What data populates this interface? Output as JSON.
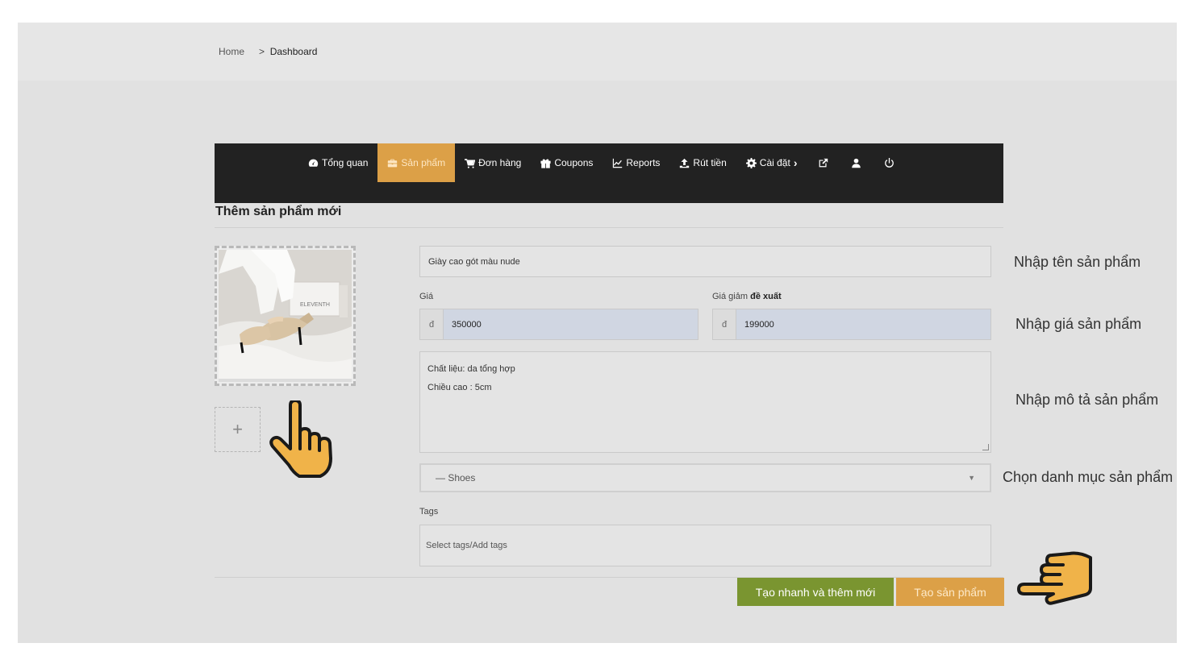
{
  "breadcrumb": {
    "home": "Home",
    "separator": ">",
    "current": "Dashboard"
  },
  "nav": {
    "items": [
      {
        "label": "Tổng quan",
        "icon": "dashboard-icon",
        "active": false
      },
      {
        "label": "Sản phẩm",
        "icon": "briefcase-icon",
        "active": true
      },
      {
        "label": "Đơn hàng",
        "icon": "cart-icon",
        "active": false
      },
      {
        "label": "Coupons",
        "icon": "gift-icon",
        "active": false
      },
      {
        "label": "Reports",
        "icon": "chart-icon",
        "active": false
      },
      {
        "label": "Rút tiền",
        "icon": "upload-icon",
        "active": false
      },
      {
        "label": "Cài đặt",
        "icon": "gear-icon",
        "active": false
      }
    ],
    "settings_chevron": "›"
  },
  "page": {
    "title": "Thêm sản phẩm mới"
  },
  "form": {
    "product_name": "Giày cao gót màu nude",
    "price_label": "Giá",
    "sale_price_label": "Giá giảm",
    "sale_price_label_bold": "đề xuất",
    "currency_symbol": "đ",
    "price": "350000",
    "sale_price": "199000",
    "description_lines": [
      "Chất liệu: da tổng hợp",
      "Chiều cao : 5cm"
    ],
    "category": "— Shoes",
    "tags_label": "Tags",
    "tags_placeholder": "Select tags/Add tags",
    "add_image": "+"
  },
  "buttons": {
    "quick_create": "Tạo nhanh và thêm mới",
    "create": "Tạo sản phẩm"
  },
  "photo": {
    "box_brand": "ELEVENTH"
  },
  "annotations": {
    "name": "Nhập tên sản phẩm",
    "price": "Nhập giá sản phẩm",
    "description": "Nhập mô tả sản phẩm",
    "category": "Chọn danh mục sản phẩm"
  },
  "colors": {
    "accent": "#dca047",
    "green": "#7a9530",
    "navbar": "#222222",
    "hand": "#f0b349"
  }
}
